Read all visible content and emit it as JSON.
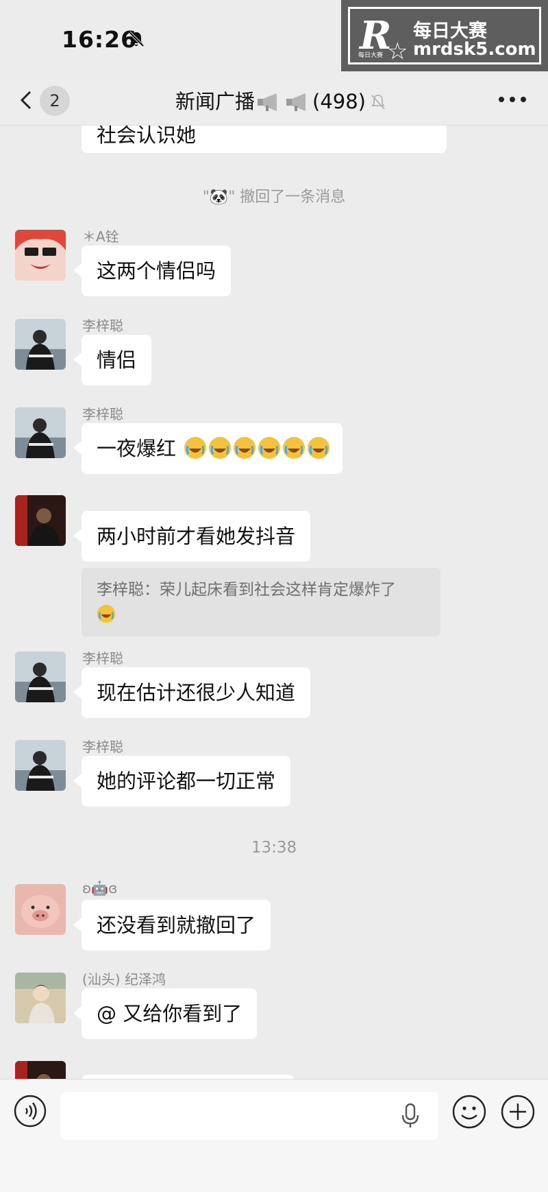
{
  "status_bar": {
    "time": "16:26"
  },
  "watermark": {
    "logo": "R",
    "logo_small": "每日大赛",
    "line1": "每日大赛",
    "line2": "mrdsk5.com"
  },
  "nav": {
    "back_badge": "2",
    "title": "新闻广播",
    "member_count": "(498)"
  },
  "messages": [
    {
      "text": "社会认识她"
    },
    {
      "system": "\"🐼\" 撤回了一条消息"
    },
    {
      "sender": "＊A铨",
      "text": "这两个情侣吗"
    },
    {
      "sender": "李梓聪",
      "text": "情侣"
    },
    {
      "sender": "李梓聪",
      "text": "一夜爆红"
    },
    {
      "text": "两小时前才看她发抖音",
      "quote": "李梓聪：荣儿起床看到社会这样肯定爆炸了"
    },
    {
      "sender": "李梓聪",
      "text": "现在估计还很少人知道"
    },
    {
      "sender": "李梓聪",
      "text": "她的评论都一切正常"
    },
    {
      "time": "13:38"
    },
    {
      "sender": "ʚ🤖ɞ",
      "text": "还没看到就撤回了"
    },
    {
      "sender": "(汕头) 纪泽鸿",
      "text": "@ 又给你看到了"
    }
  ],
  "input": {
    "placeholder": ""
  },
  "colors": {
    "background": "#ececec",
    "bubble": "#ffffff",
    "quote_bg": "#e2e2e2"
  }
}
